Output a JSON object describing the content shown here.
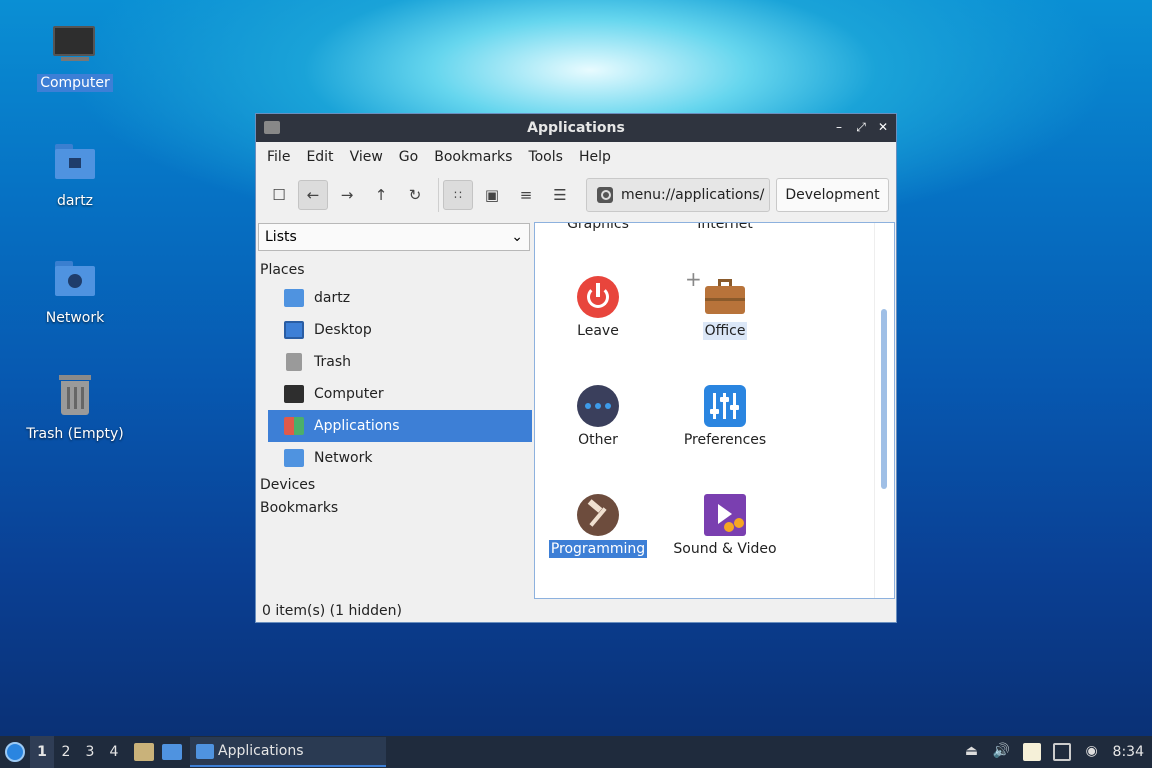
{
  "desktop": {
    "icons": [
      {
        "label": "Computer"
      },
      {
        "label": "dartz"
      },
      {
        "label": "Network"
      },
      {
        "label": "Trash (Empty)"
      }
    ]
  },
  "window": {
    "title": "Applications",
    "controls": {
      "minimize": "–",
      "maximize": "⤢",
      "close": "✕"
    },
    "menu": [
      "File",
      "Edit",
      "View",
      "Go",
      "Bookmarks",
      "Tools",
      "Help"
    ],
    "toolbar": {
      "path": "menu://applications/",
      "breadcrumb": "Development"
    },
    "sidebar": {
      "combo_value": "Lists",
      "places_label": "Places",
      "places": [
        "dartz",
        "Desktop",
        "Trash",
        "Computer",
        "Applications",
        "Network"
      ],
      "devices_label": "Devices",
      "bookmarks_label": "Bookmarks"
    },
    "content": {
      "partial_top": [
        "Graphics",
        "Internet"
      ],
      "categories": [
        "Leave",
        "Office",
        "Other",
        "Preferences",
        "Programming",
        "Sound & Video"
      ]
    },
    "status": "0 item(s) (1 hidden)"
  },
  "taskbar": {
    "workspaces": [
      "1",
      "2",
      "3",
      "4"
    ],
    "task_label": "Applications",
    "clock": "8:34"
  },
  "colors": {
    "accent": "#3d7fd6",
    "titlebar": "#2f343f",
    "taskbar": "#1f2b3d"
  }
}
